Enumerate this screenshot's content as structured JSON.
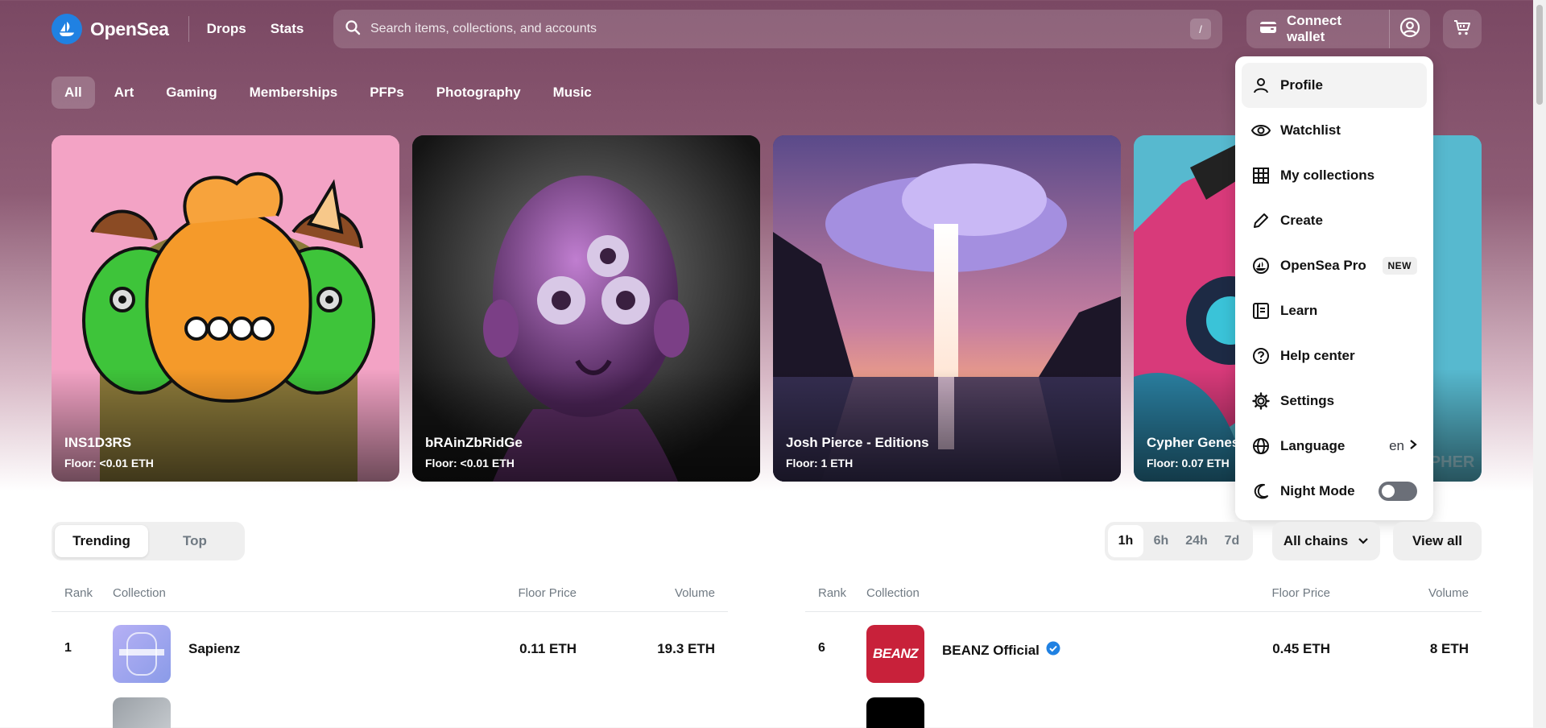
{
  "header": {
    "logo_text": "OpenSea",
    "nav": [
      "Drops",
      "Stats"
    ],
    "search_placeholder": "Search items, collections, and accounts",
    "search_shortcut": "/",
    "connect_wallet": "Connect wallet"
  },
  "categories": [
    "All",
    "Art",
    "Gaming",
    "Memberships",
    "PFPs",
    "Photography",
    "Music"
  ],
  "active_category": "All",
  "featured": [
    {
      "title": "INS1D3RS",
      "floor": "Floor: <0.01 ETH"
    },
    {
      "title": "bRAinZbRidGe",
      "floor": "Floor: <0.01 ETH"
    },
    {
      "title": "Josh Pierce - Editions",
      "floor": "Floor: 1 ETH"
    },
    {
      "title": "Cypher Genes",
      "floor": "Floor: 0.07 ETH"
    }
  ],
  "menu": {
    "profile": "Profile",
    "watchlist": "Watchlist",
    "my_collections": "My collections",
    "create": "Create",
    "opensea_pro": "OpenSea Pro",
    "new_badge": "NEW",
    "learn": "Learn",
    "help_center": "Help center",
    "settings": "Settings",
    "language": "Language",
    "language_value": "en",
    "night_mode": "Night Mode",
    "night_mode_on": false
  },
  "trending": {
    "tabs": [
      "Trending",
      "Top"
    ],
    "active_tab": "Trending",
    "time_ranges": [
      "1h",
      "6h",
      "24h",
      "7d"
    ],
    "active_time": "1h",
    "chains_label": "All chains",
    "view_all": "View all",
    "columns": {
      "rank": "Rank",
      "collection": "Collection",
      "floor": "Floor Price",
      "volume": "Volume"
    },
    "left_rows": [
      {
        "rank": "1",
        "name": "Sapienz",
        "floor": "0.11 ETH",
        "volume": "19.3 ETH",
        "verified": false
      }
    ],
    "right_rows": [
      {
        "rank": "6",
        "name": "BEANZ Official",
        "floor": "0.45 ETH",
        "volume": "8 ETH",
        "verified": true
      }
    ],
    "thumb_text": {
      "beanz": "BEANZ"
    }
  },
  "colors": {
    "brand": "#2081e2",
    "verified": "#2081e2"
  }
}
